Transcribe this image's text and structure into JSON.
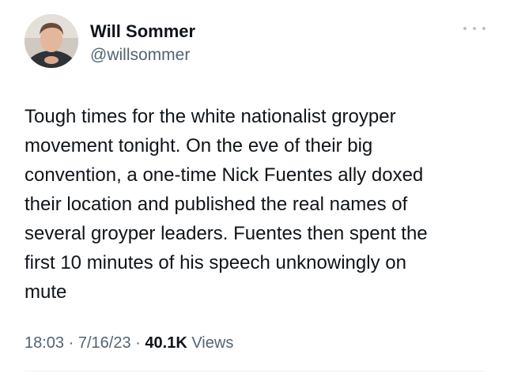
{
  "author": {
    "name": "Will Sommer",
    "handle": "@willsommer"
  },
  "tweet": {
    "text_lines": [
      "Tough times for the white nationalist groyper",
      "movement tonight. On the eve of their big",
      "convention, a one-time Nick Fuentes ally doxed",
      "their location and published the real names of",
      "several groyper leaders. Fuentes then spent the",
      "first 10 minutes of his speech unknowingly on",
      "mute"
    ]
  },
  "meta": {
    "time": "18:03",
    "separator": "·",
    "date": "7/16/23",
    "views_count": "40.1K",
    "views_label": "Views"
  },
  "icons": {
    "more": "more-horizontal-icon",
    "avatar": "profile-avatar"
  },
  "colors": {
    "text_primary": "#0f1419",
    "text_secondary": "#536471",
    "more_dots": "#b6c2cb",
    "divider": "#eff3f4"
  }
}
